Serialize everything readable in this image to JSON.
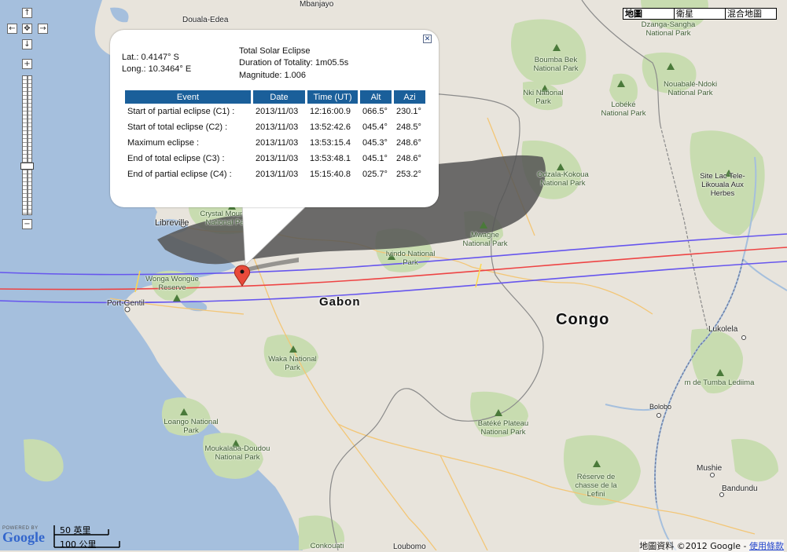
{
  "map_type": {
    "options": [
      "地圖",
      "衛星",
      "混合地圖"
    ],
    "active": "地圖"
  },
  "nav": {
    "up": "↑",
    "down": "↓",
    "left": "←",
    "right": "→",
    "center": "✥",
    "zoom_in": "+",
    "zoom_out": "−",
    "zoom_level_fraction": 0.37
  },
  "countries": [
    "Gabon",
    "Congo"
  ],
  "cities": [
    "Douala-Edea",
    "Mbanjayo",
    "Libreville",
    "Port-Gentil",
    "Lukolela",
    "Bolobo",
    "Mushie",
    "Bandundu",
    "Loubomo"
  ],
  "parks": [
    "Dzanga-Sangha National Park",
    "Boumba Bek National Park",
    "Nki National Park",
    "Nouabalé-Ndoki National Park",
    "Lobéké National Park",
    "Odzala-Kokoua National Park",
    "Site Lac Tele-Likouala Aux Herbes",
    "Crystal Mountain National Park",
    "Wonga Wongue Reserve",
    "Ivindo National Park",
    "Mwagne National Park",
    "Waka National Park",
    "Loango National Park",
    "Moukalaba-Doudou National Park",
    "Batéké Plateau National Park",
    "Réserve de chasse de la Lefini",
    "Conkouati",
    "m de Tumba Lediima"
  ],
  "info": {
    "lat": "Lat.: 0.4147° S",
    "long": "Long.: 10.3464° E",
    "eclipse_type": "Total Solar Eclipse",
    "duration": "Duration of Totality: 1m05.5s",
    "magnitude": "Magnitude: 1.006",
    "close": "✕",
    "columns": [
      "Event",
      "Date",
      "Time (UT)",
      "Alt",
      "Azi"
    ],
    "rows": [
      [
        "Start of partial eclipse (C1) :",
        "2013/11/03",
        "12:16:00.9",
        "066.5°",
        "230.1°"
      ],
      [
        "Start of total eclipse (C2) :",
        "2013/11/03",
        "13:52:42.6",
        "045.4°",
        "248.5°"
      ],
      [
        "Maximum eclipse :",
        "2013/11/03",
        "13:53:15.4",
        "045.3°",
        "248.6°"
      ],
      [
        "End of total eclipse (C3) :",
        "2013/11/03",
        "13:53:48.1",
        "045.1°",
        "248.6°"
      ],
      [
        "End of partial eclipse (C4) :",
        "2013/11/03",
        "15:15:40.8",
        "025.7°",
        "253.2°"
      ]
    ]
  },
  "logo": {
    "powered_by": "POWERED BY",
    "name": "Google"
  },
  "scale": {
    "imperial": "50 英里",
    "metric": "100 公里"
  },
  "footer": {
    "copyright": "地圖資料 ©2012 Google - ",
    "terms": "使用條款"
  },
  "colors": {
    "centerline": "#ee4444",
    "limits": "#6655ee",
    "land": "#e8e4dc",
    "water": "#a5bfdd",
    "park": "#c8dcb0",
    "table_header": "#1a5f9a"
  }
}
